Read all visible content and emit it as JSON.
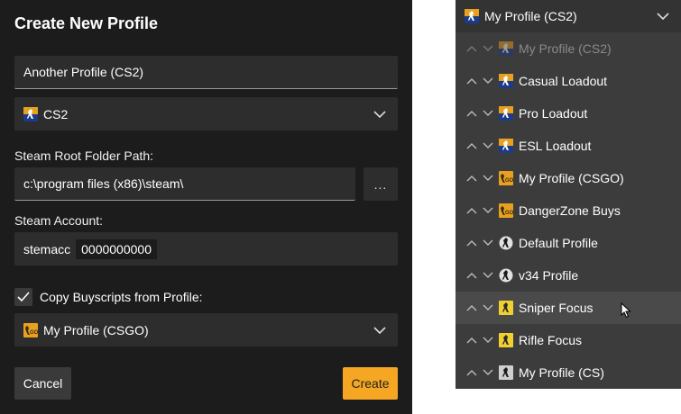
{
  "dialog": {
    "title": "Create New Profile",
    "profile_name": "Another Profile (CS2)",
    "game_select": "CS2",
    "steam_root_label": "Steam Root Folder Path:",
    "steam_root_value": "c:\\program files (x86)\\steam\\",
    "browse_label": "...",
    "steam_account_label": "Steam Account:",
    "account_name": "stemacc",
    "account_id": "0000000000",
    "copy_label": "Copy Buyscripts from Profile:",
    "copy_from_profile": "My Profile (CSGO)",
    "cancel_label": "Cancel",
    "create_label": "Create"
  },
  "dropdown": {
    "selected": "My Profile (CS2)",
    "items": [
      {
        "label": "My Profile (CS2)",
        "icon": "cs2-icon",
        "disabled": true
      },
      {
        "label": "Casual Loadout",
        "icon": "cs2-icon"
      },
      {
        "label": "Pro Loadout",
        "icon": "cs2-icon"
      },
      {
        "label": "ESL Loadout",
        "icon": "cs2-icon"
      },
      {
        "label": "My Profile (CSGO)",
        "icon": "csgo-icon"
      },
      {
        "label": "DangerZone Buys",
        "icon": "csgo-icon"
      },
      {
        "label": "Default Profile",
        "icon": "css-icon"
      },
      {
        "label": "v34 Profile",
        "icon": "css-icon"
      },
      {
        "label": "Sniper Focus",
        "icon": "cs16-icon",
        "hover": true
      },
      {
        "label": "Rifle Focus",
        "icon": "cs16-icon"
      },
      {
        "label": "My Profile (CS)",
        "icon": "cs-icon"
      }
    ]
  },
  "colors": {
    "accent": "#f5a623",
    "dialog_bg": "#1c1c1c",
    "field_bg": "#2d2d2d",
    "dropdown_bg": "#3c3c3c"
  }
}
